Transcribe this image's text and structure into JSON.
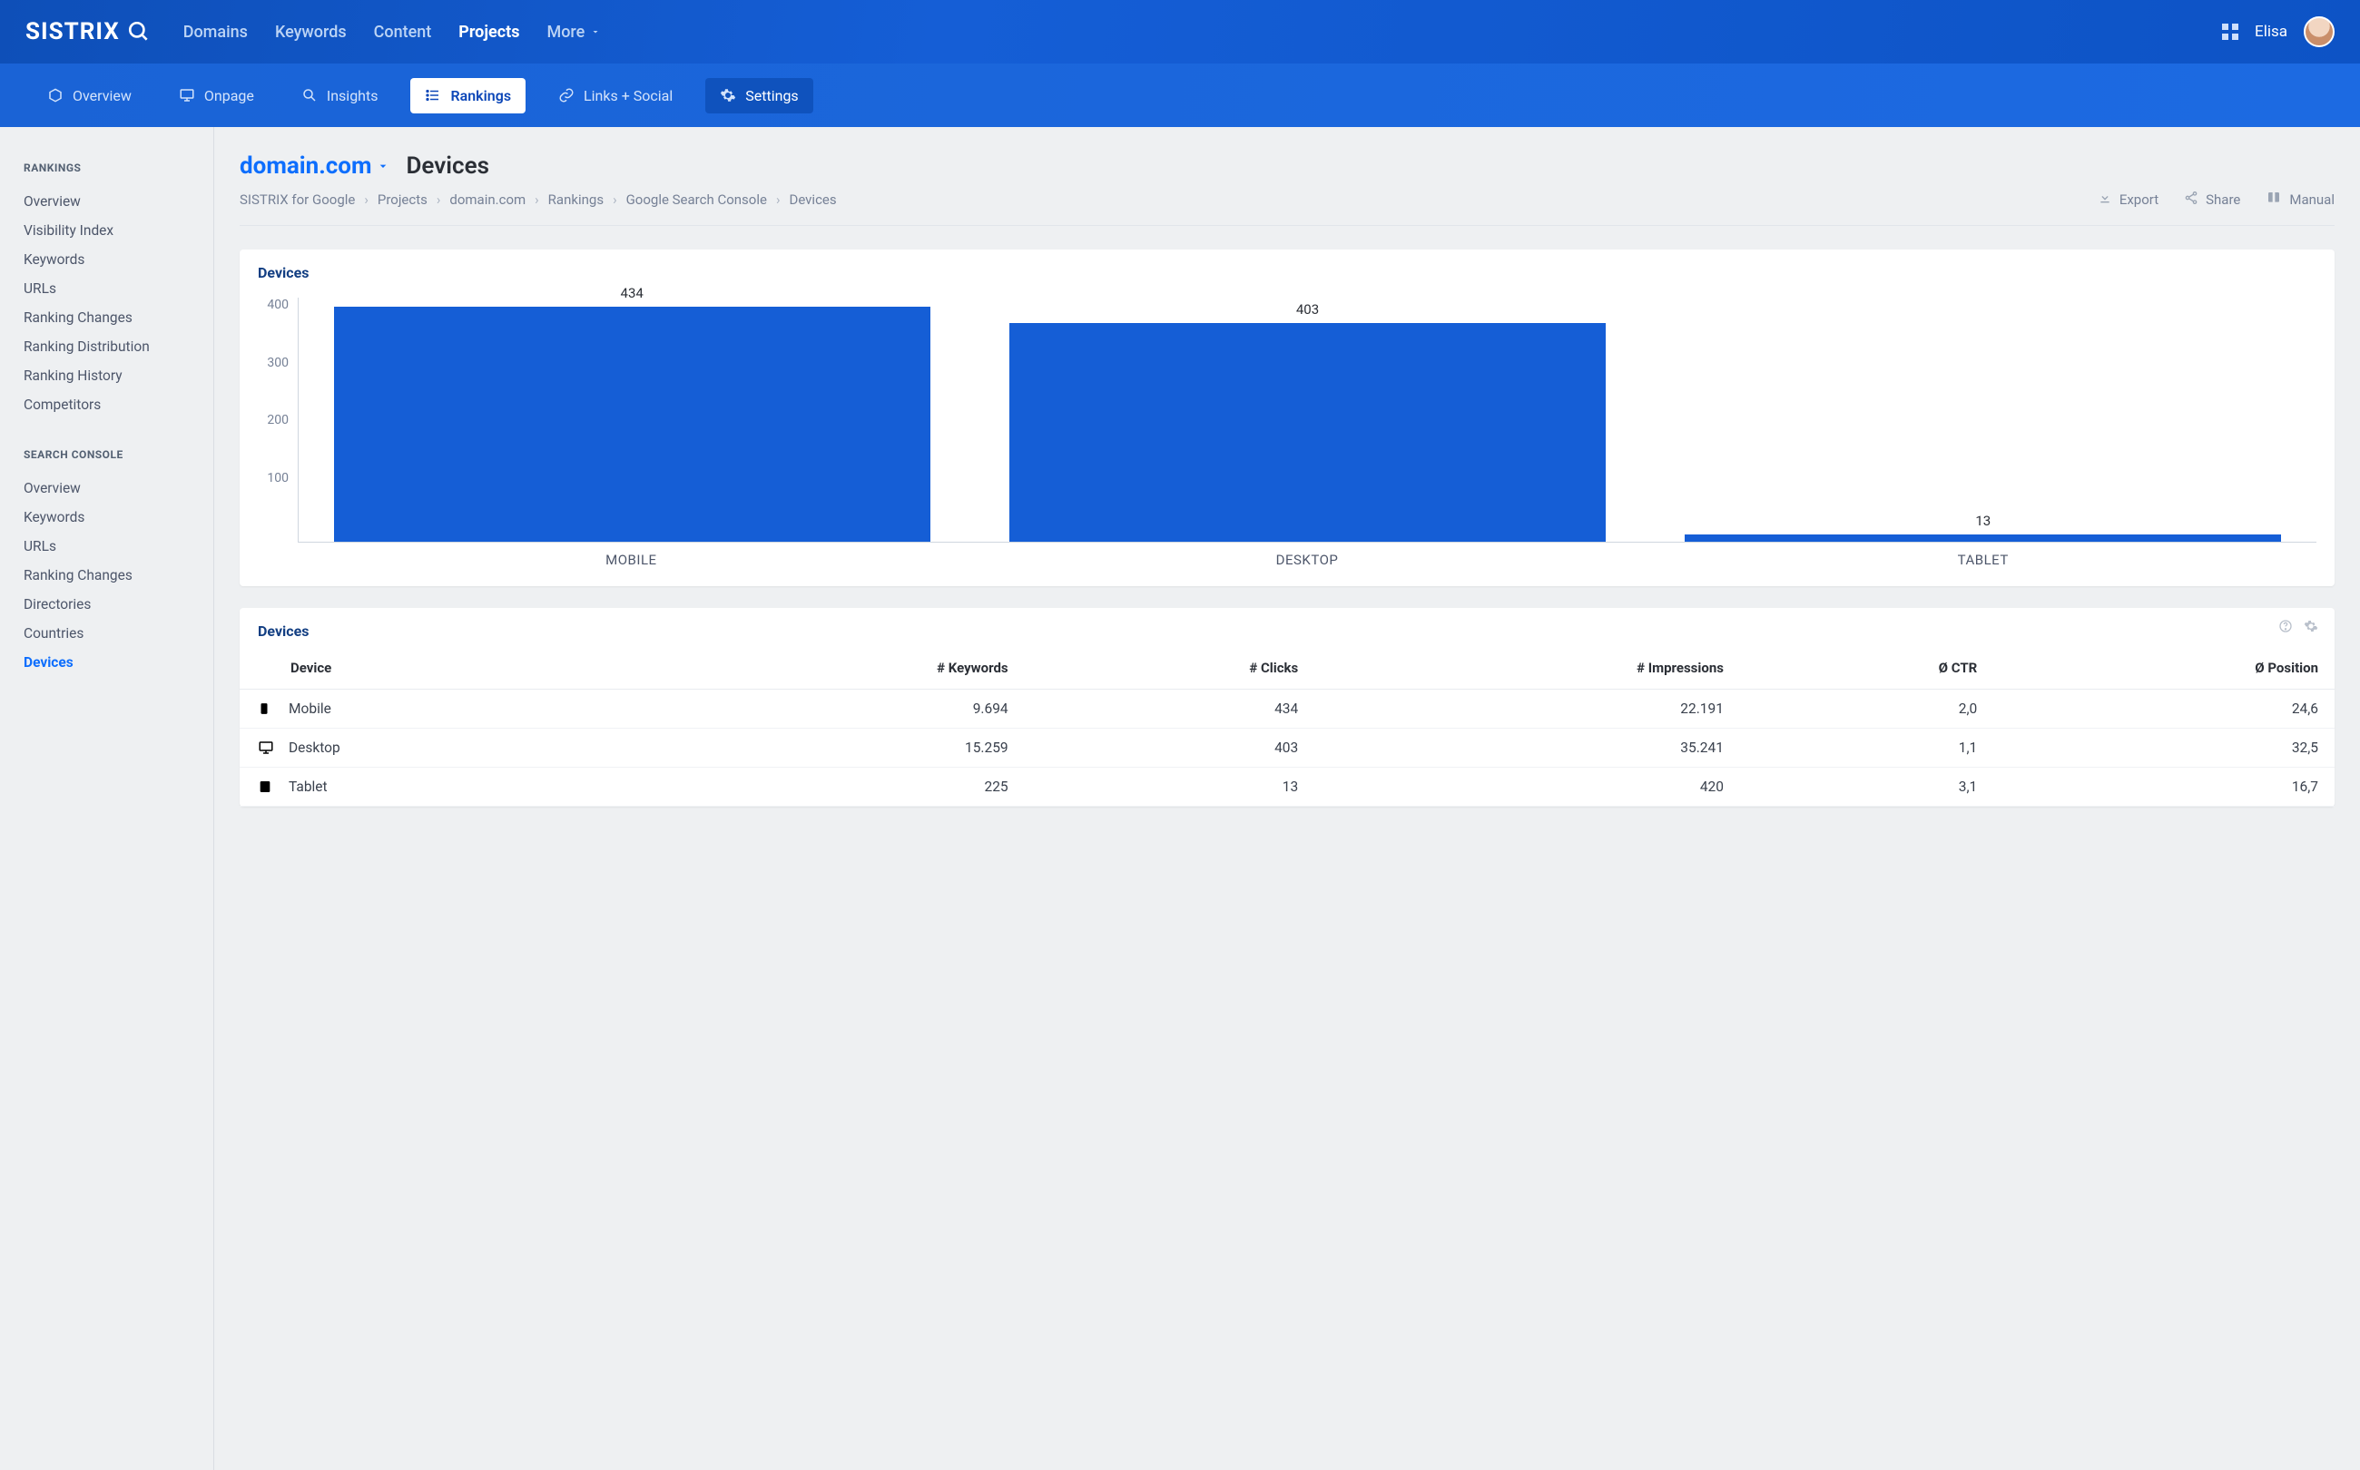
{
  "brand": "SISTRIX",
  "topnav": {
    "items": [
      {
        "label": "Domains"
      },
      {
        "label": "Keywords"
      },
      {
        "label": "Content"
      },
      {
        "label": "Projects",
        "active": true
      },
      {
        "label": "More",
        "caret": true
      }
    ]
  },
  "user": {
    "name": "Elisa"
  },
  "secnav": {
    "items": [
      {
        "icon": "cube-icon",
        "label": "Overview"
      },
      {
        "icon": "monitor-icon",
        "label": "Onpage"
      },
      {
        "icon": "search-icon",
        "label": "Insights"
      },
      {
        "icon": "list-icon",
        "label": "Rankings",
        "active": true
      },
      {
        "icon": "link-icon",
        "label": "Links + Social"
      },
      {
        "icon": "gear-icon",
        "label": "Settings",
        "box": true
      }
    ]
  },
  "sidebar": {
    "groups": [
      {
        "title": "RANKINGS",
        "items": [
          {
            "label": "Overview"
          },
          {
            "label": "Visibility Index"
          },
          {
            "label": "Keywords"
          },
          {
            "label": "URLs"
          },
          {
            "label": "Ranking Changes"
          },
          {
            "label": "Ranking Distribution"
          },
          {
            "label": "Ranking History"
          },
          {
            "label": "Competitors"
          }
        ]
      },
      {
        "title": "SEARCH CONSOLE",
        "items": [
          {
            "label": "Overview"
          },
          {
            "label": "Keywords"
          },
          {
            "label": "URLs"
          },
          {
            "label": "Ranking Changes"
          },
          {
            "label": "Directories"
          },
          {
            "label": "Countries"
          },
          {
            "label": "Devices",
            "active": true
          }
        ]
      }
    ]
  },
  "page": {
    "domain": "domain.com",
    "title": "Devices",
    "breadcrumbs": [
      "SISTRIX for Google",
      "Projects",
      "domain.com",
      "Rankings",
      "Google Search Console",
      "Devices"
    ],
    "actions": [
      {
        "icon": "download-icon",
        "label": "Export"
      },
      {
        "icon": "share-icon",
        "label": "Share"
      },
      {
        "icon": "book-icon",
        "label": "Manual"
      }
    ]
  },
  "chart_card": {
    "title": "Devices"
  },
  "chart_data": {
    "type": "bar",
    "categories": [
      "MOBILE",
      "DESKTOP",
      "TABLET"
    ],
    "values": [
      434,
      403,
      13
    ],
    "ylim": [
      0,
      450
    ],
    "yticks": [
      100,
      200,
      300,
      400
    ],
    "ylabel": "",
    "xlabel": "",
    "title": "Devices"
  },
  "table_card": {
    "title": "Devices"
  },
  "table": {
    "columns": [
      "Device",
      "# Keywords",
      "# Clicks",
      "# Impressions",
      "Ø CTR",
      "Ø Position"
    ],
    "rows": [
      {
        "icon": "mobile-icon",
        "device": "Mobile",
        "keywords": "9.694",
        "clicks": "434",
        "impressions": "22.191",
        "ctr": "2,0",
        "position": "24,6"
      },
      {
        "icon": "desktop-icon",
        "device": "Desktop",
        "keywords": "15.259",
        "clicks": "403",
        "impressions": "35.241",
        "ctr": "1,1",
        "position": "32,5"
      },
      {
        "icon": "tablet-icon",
        "device": "Tablet",
        "keywords": "225",
        "clicks": "13",
        "impressions": "420",
        "ctr": "3,1",
        "position": "16,7"
      }
    ]
  },
  "colors": {
    "accent": "#155ed6",
    "link": "#0d6efd"
  }
}
